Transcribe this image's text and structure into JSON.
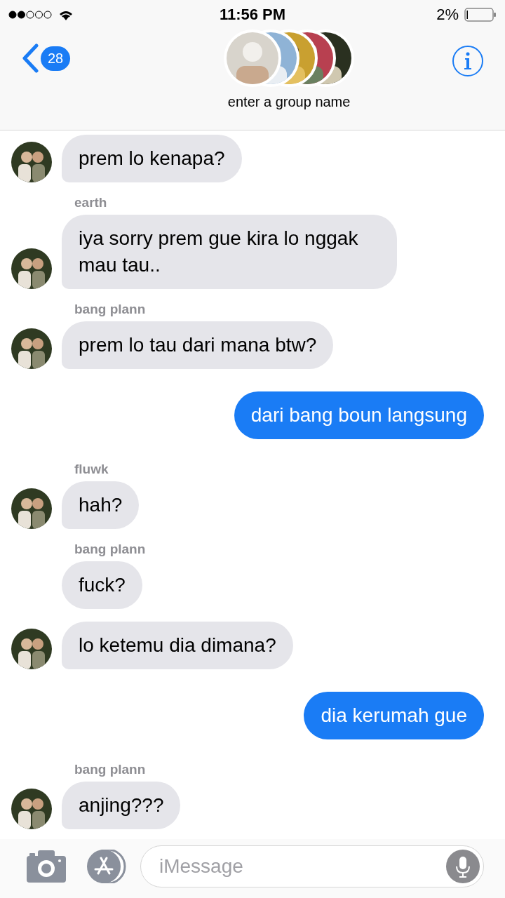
{
  "status_bar": {
    "time": "11:56 PM",
    "battery": "2%"
  },
  "header": {
    "back_count": "28",
    "group_name": "enter a group name"
  },
  "messages": [
    {
      "kind": "incoming",
      "text": "prem lo kenapa?",
      "avatar": true
    },
    {
      "kind": "incoming",
      "sender": "earth",
      "text": "iya sorry prem gue kira lo nggak mau tau..",
      "avatar": true
    },
    {
      "kind": "incoming",
      "sender": "bang plann",
      "text": "prem lo tau dari mana btw?",
      "avatar": true
    },
    {
      "kind": "outgoing",
      "text": "dari bang boun langsung"
    },
    {
      "kind": "incoming",
      "sender": "fluwk",
      "text": "hah?",
      "avatar": true
    },
    {
      "kind": "incoming",
      "sender": "bang plann",
      "text": "fuck?",
      "avatar": false
    },
    {
      "kind": "incoming",
      "text": "lo ketemu dia dimana?",
      "avatar": true
    },
    {
      "kind": "outgoing",
      "text": "dia kerumah gue"
    },
    {
      "kind": "incoming",
      "sender": "bang plann",
      "text": "anjing???",
      "avatar": true
    }
  ],
  "composer": {
    "placeholder": "iMessage"
  }
}
